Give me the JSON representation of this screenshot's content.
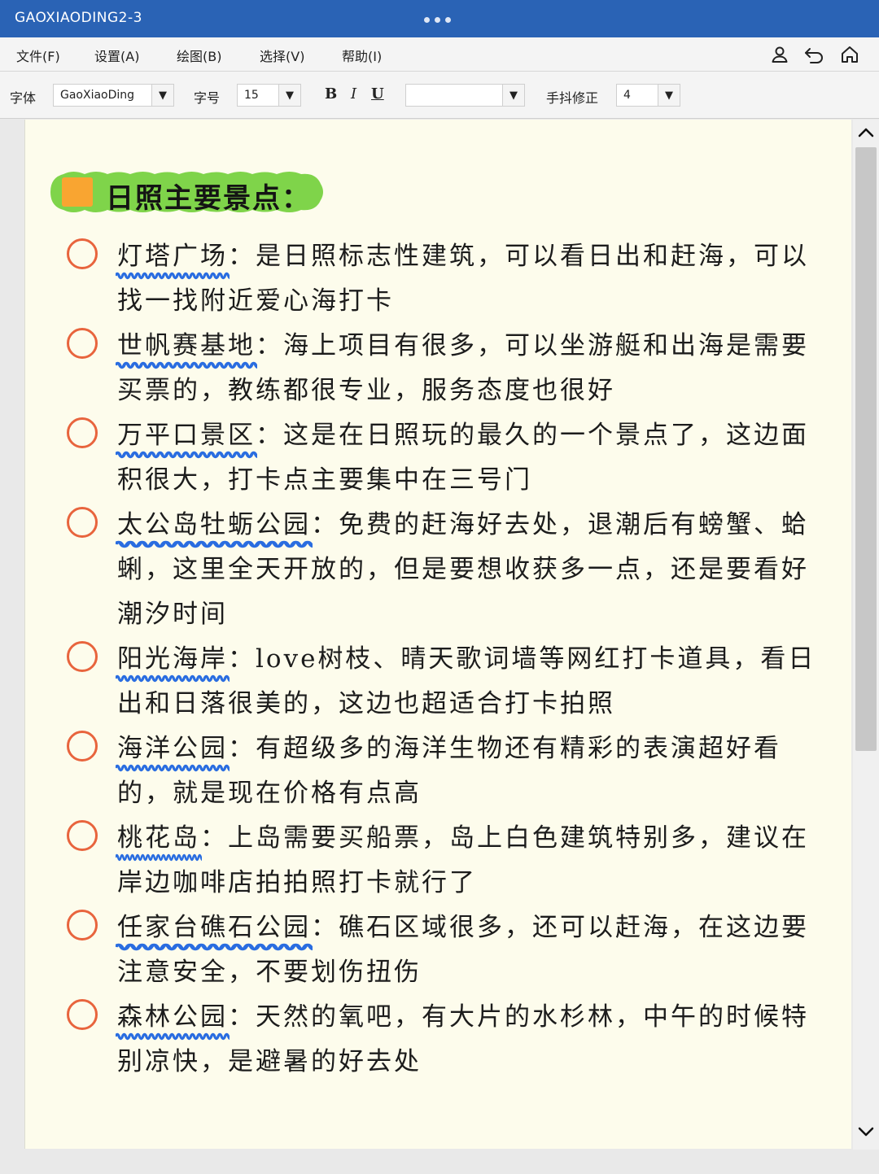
{
  "window": {
    "title": "GAOXIAODING2-3"
  },
  "menu": [
    {
      "label": "文件(F)"
    },
    {
      "label": "设置(A)"
    },
    {
      "label": "绘图(B)"
    },
    {
      "label": "选择(V)"
    },
    {
      "label": "帮助(I)"
    }
  ],
  "toolbar": {
    "font_label": "字体",
    "font_value": "GaoXiaoDing",
    "size_label": "字号",
    "size_value": "15",
    "bold": "B",
    "italic": "I",
    "underline": "U",
    "color_value": "",
    "jitter_label": "手抖修正",
    "jitter_value": "4"
  },
  "icons": [
    "user-icon",
    "undo-icon",
    "home-icon",
    "chevron-up-icon",
    "chevron-down-icon"
  ],
  "colors": {
    "titlebar": "#2a63b5",
    "paper": "#fdfcec",
    "bullet": "#e8643d",
    "wave": "#2a6de0",
    "highlight": "#7fd44a",
    "square": "#f9a531"
  },
  "document": {
    "heading": "日照主要景点：",
    "entries": [
      {
        "place": "灯塔广场",
        "desc": "：是日照标志性建筑，可以看日出和赶海，可以找一找附近爱心海打卡"
      },
      {
        "place": "世帆赛基地",
        "desc": "：海上项目有很多，可以坐游艇和出海是需要买票的，教练都很专业，服务态度也很好"
      },
      {
        "place": "万平口景区",
        "desc": "：这是在日照玩的最久的一个景点了，这边面积很大，打卡点主要集中在三号门"
      },
      {
        "place": "太公岛牡蛎公园",
        "desc": "：免费的赶海好去处，退潮后有螃蟹、蛤蜊，这里全天开放的，但是要想收获多一点，还是要看好潮汐时间"
      },
      {
        "place": "阳光海岸",
        "desc": "：love树枝、晴天歌词墙等网红打卡道具，看日出和日落很美的，这边也超适合打卡拍照"
      },
      {
        "place": "海洋公园",
        "desc": "：有超级多的海洋生物还有精彩的表演超好看的，就是现在价格有点高"
      },
      {
        "place": "桃花岛",
        "desc": "：上岛需要买船票，岛上白色建筑特别多，建议在岸边咖啡店拍拍照打卡就行了"
      },
      {
        "place": "任家台礁石公园",
        "desc": "：礁石区域很多，还可以赶海，在这边要注意安全，不要划伤扭伤"
      },
      {
        "place": "森林公园",
        "desc": "：天然的氧吧，有大片的水杉林，中午的时候特别凉快，是避暑的好去处"
      }
    ]
  }
}
